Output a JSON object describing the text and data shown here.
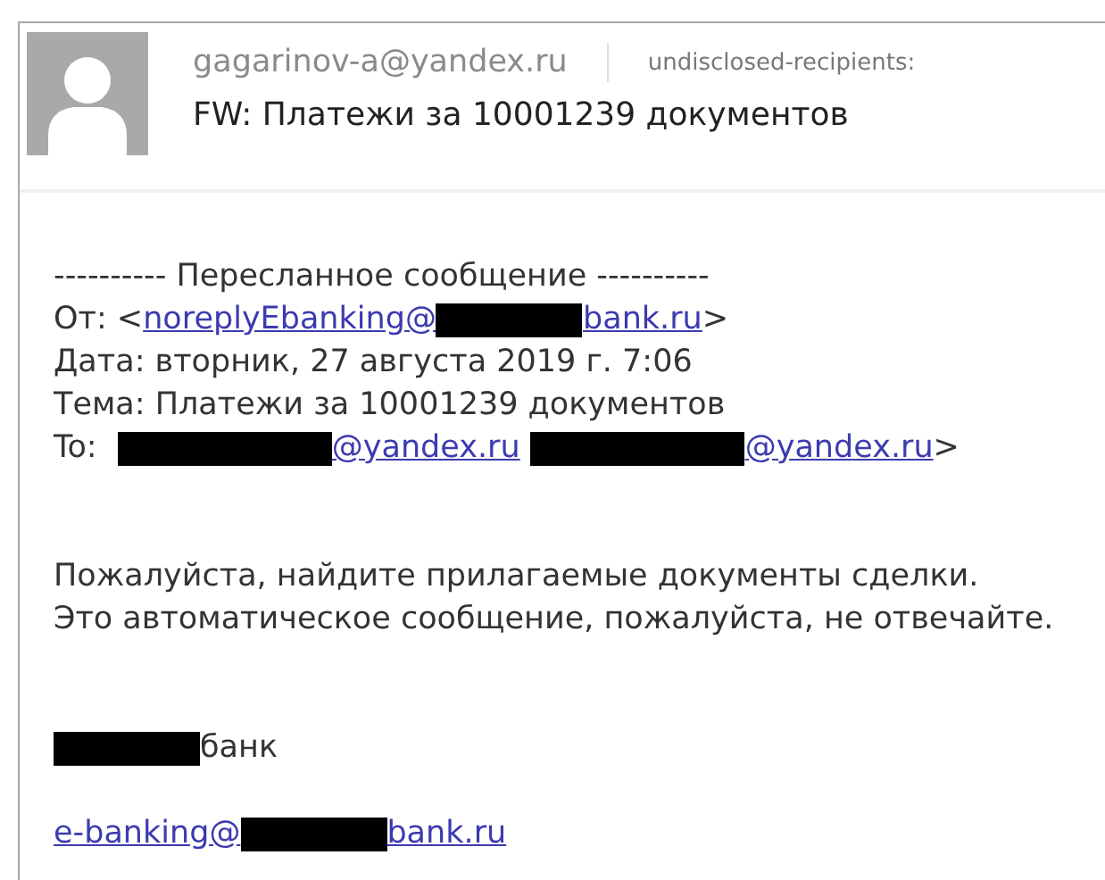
{
  "header": {
    "sender": "gagarinov-a@yandex.ru",
    "recipients": "undisclosed-recipients:",
    "subject": "FW: Платежи за 10001239 документов"
  },
  "body": [
    {
      "kind": "line",
      "segments": [
        {
          "kind": "text",
          "text": "---------- Пересланное сообщение ----------"
        }
      ]
    },
    {
      "kind": "line",
      "segments": [
        {
          "kind": "text",
          "text": "От: <"
        },
        {
          "kind": "link",
          "text": "noreplyEbanking@"
        },
        {
          "kind": "redaction"
        },
        {
          "kind": "link",
          "text": "bank.ru"
        },
        {
          "kind": "text",
          "text": ">"
        }
      ]
    },
    {
      "kind": "line",
      "segments": [
        {
          "kind": "text",
          "text": "Дата: вторник, 27 августа 2019 г. 7:06"
        }
      ]
    },
    {
      "kind": "line",
      "segments": [
        {
          "kind": "text",
          "text": "Тема: Платежи за 10001239 документов"
        }
      ]
    },
    {
      "kind": "line",
      "segments": [
        {
          "kind": "text",
          "text": "To: "
        },
        {
          "kind": "wide_redaction"
        },
        {
          "kind": "link",
          "text": "@yandex.ru"
        },
        {
          "kind": "wide_redaction"
        },
        {
          "kind": "link",
          "text": "@yandex.ru"
        },
        {
          "kind": "text",
          "text": ">"
        }
      ]
    },
    {
      "kind": "gap"
    },
    {
      "kind": "gap"
    },
    {
      "kind": "line",
      "segments": [
        {
          "kind": "text",
          "text": "Пожалуйста, найдите прилагаемые документы сделки."
        }
      ]
    },
    {
      "kind": "line",
      "segments": [
        {
          "kind": "text",
          "text": "Это автоматическое сообщение, пожалуйста, не отвечайте."
        }
      ]
    },
    {
      "kind": "gap"
    },
    {
      "kind": "gap"
    },
    {
      "kind": "line",
      "segments": [
        {
          "kind": "redaction"
        },
        {
          "kind": "text",
          "text": "банк"
        }
      ]
    },
    {
      "kind": "gap"
    },
    {
      "kind": "line",
      "segments": [
        {
          "kind": "link",
          "text": "e-banking@"
        },
        {
          "kind": "redaction"
        },
        {
          "kind": "link",
          "text": "bank.ru"
        }
      ]
    }
  ]
}
